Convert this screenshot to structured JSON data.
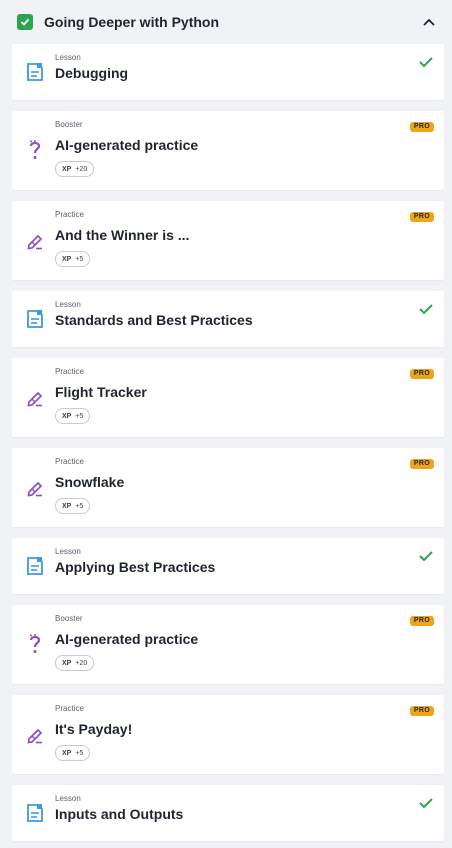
{
  "section": {
    "title": "Going Deeper with Python"
  },
  "items": [
    {
      "kind": "Lesson",
      "title": "Debugging"
    },
    {
      "kind": "Booster",
      "title": "AI-generated practice",
      "pro": "PRO",
      "xp_label": "XP",
      "xp_value": "+20"
    },
    {
      "kind": "Practice",
      "title": "And the Winner is ...",
      "pro": "PRO",
      "xp_label": "XP",
      "xp_value": "+5"
    },
    {
      "kind": "Lesson",
      "title": "Standards and Best Practices"
    },
    {
      "kind": "Practice",
      "title": "Flight Tracker",
      "pro": "PRO",
      "xp_label": "XP",
      "xp_value": "+5"
    },
    {
      "kind": "Practice",
      "title": "Snowflake",
      "pro": "PRO",
      "xp_label": "XP",
      "xp_value": "+5"
    },
    {
      "kind": "Lesson",
      "title": "Applying Best Practices"
    },
    {
      "kind": "Booster",
      "title": "AI-generated practice",
      "pro": "PRO",
      "xp_label": "XP",
      "xp_value": "+20"
    },
    {
      "kind": "Practice",
      "title": "It's Payday!",
      "pro": "PRO",
      "xp_label": "XP",
      "xp_value": "+5"
    },
    {
      "kind": "Lesson",
      "title": "Inputs and Outputs"
    }
  ],
  "colors": {
    "lesson_icon": "#3a9be0",
    "practice_icon": "#8a4fc9",
    "done": "#2ea44f",
    "pro_badge": "#f0a41c"
  },
  "icons": {
    "lesson": "document-icon",
    "booster": "question-mark-icon",
    "practice": "pencil-icon",
    "done": "checkmark-icon"
  }
}
